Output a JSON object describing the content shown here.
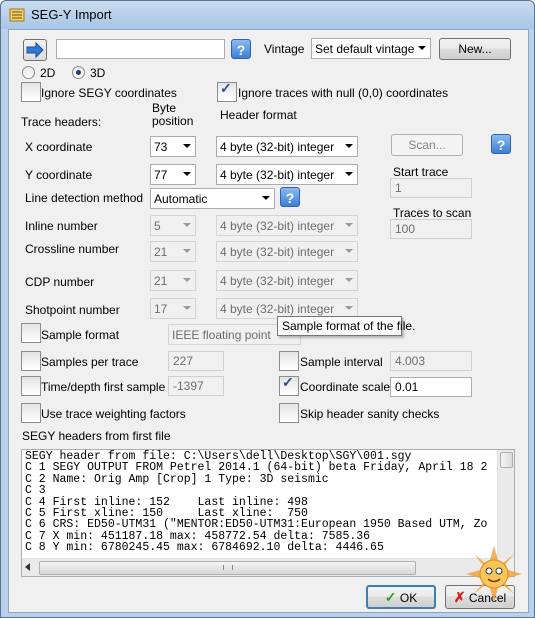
{
  "window": {
    "title": "SEG-Y Import"
  },
  "top": {
    "file_value": "",
    "help_label": "?",
    "vintage_label": "Vintage",
    "vintage_value": "Set default vintage",
    "new_label": "New..."
  },
  "dims": {
    "d2_label": "2D",
    "d3_label": "3D",
    "selected": "3D"
  },
  "options": {
    "ignore_segy_label": "Ignore SEGY coordinates",
    "ignore_null_label": "Ignore traces with null (0,0) coordinates",
    "ignore_null_checked": true
  },
  "headers": {
    "trace_headers_label": "Trace headers:",
    "byte_position_label_1": "Byte",
    "byte_position_label_2": "position",
    "header_format_label": "Header format",
    "x_label": "X coordinate",
    "x_byte": "73",
    "x_format": "4 byte (32-bit) integer",
    "y_label": "Y coordinate",
    "y_byte": "77",
    "y_format": "4 byte (32-bit) integer",
    "line_detect_label": "Line detection method",
    "line_detect_value": "Automatic",
    "inline_label": "Inline number",
    "inline_byte": "5",
    "inline_format": "4 byte (32-bit) integer",
    "crossline_label": "Crossline number",
    "crossline_byte": "21",
    "crossline_format": "4 byte (32-bit) integer",
    "cdp_label": "CDP number",
    "cdp_byte": "21",
    "cdp_format": "4 byte (32-bit) integer",
    "shotpoint_label": "Shotpoint number",
    "shotpoint_byte": "17",
    "shotpoint_format": "4 byte (32-bit) integer"
  },
  "scan": {
    "scan_label": "Scan...",
    "start_trace_label": "Start trace",
    "start_trace_value": "1",
    "traces_to_scan_label": "Traces to scan",
    "traces_to_scan_value": "100"
  },
  "sample": {
    "sample_format_label": "Sample format",
    "sample_format_value": "IEEE floating point",
    "tooltip": "Sample format of the file.",
    "samples_per_trace_label": "Samples per trace",
    "samples_per_trace_value": "227",
    "sample_interval_label": "Sample interval",
    "sample_interval_value": "4.003",
    "first_sample_label": "Time/depth first sample",
    "first_sample_value": "-1397",
    "coord_scale_label": "Coordinate scale",
    "coord_scale_value": "0.01",
    "coord_scale_checked": true,
    "weighting_label": "Use trace weighting factors",
    "skip_sanity_label": "Skip header sanity checks"
  },
  "segy_headers": {
    "label": "SEGY headers from first file",
    "lines": "SEGY header from file: C:\\Users\\dell\\Desktop\\SGY\\001.sgy\nC 1 SEGY OUTPUT FROM Petrel 2014.1 (64-bit) beta Friday, April 18 2\nC 2 Name: Orig Amp [Crop] 1 Type: 3D seismic\nC 3\nC 4 First inline: 152    Last inline: 498\nC 5 First xline: 150     Last xline:  750\nC 6 CRS: ED50-UTM31 (\"MENTOR:ED50-UTM31:European 1950 Based UTM, Zo\nC 7 X min: 451187.18 max: 458772.54 delta: 7585.36\nC 8 Y min: 6780245.45 max: 6784692.10 delta: 4446.65"
  },
  "buttons": {
    "ok_label": "OK",
    "cancel_label": "Cancel"
  },
  "colors": {
    "title_bar": "#b9d1ea",
    "help_blue": "#3c7fd6",
    "ok_check": "#2e9e2e",
    "cancel_x": "#d22020"
  }
}
